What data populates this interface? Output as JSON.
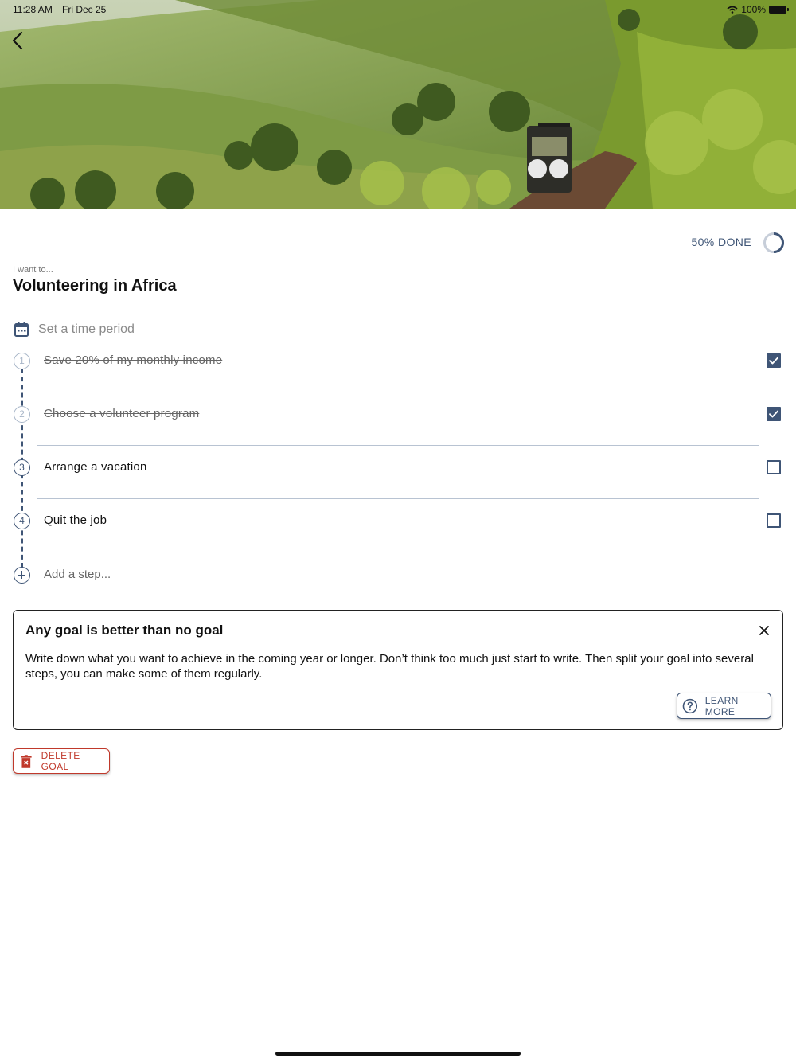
{
  "status_bar": {
    "time": "11:28 AM",
    "date": "Fri Dec 25",
    "battery": "100%"
  },
  "hero": {
    "image_icon": "safari-landscape-photo"
  },
  "progress": {
    "label": "50% DONE",
    "value": 0.5
  },
  "goal": {
    "prompt": "I want to...",
    "title": "Volunteering in Africa"
  },
  "time_period": {
    "label": "Set a time period"
  },
  "steps": [
    {
      "number": "1",
      "text": "Save 20% of my monthly income",
      "done": true
    },
    {
      "number": "2",
      "text": "Choose a volunteer program",
      "done": true
    },
    {
      "number": "3",
      "text": "Arrange a vacation",
      "done": false
    },
    {
      "number": "4",
      "text": "Quit the job",
      "done": false
    }
  ],
  "add_step": {
    "placeholder": "Add a step..."
  },
  "tip": {
    "title": "Any goal is better than no goal",
    "body": "Write down what you want to achieve in the coming year or longer. Don’t think too much just start to write. Then split your goal into several steps, you can make some of them regularly.",
    "learn_more_label": "LEARN MORE"
  },
  "delete": {
    "label": "DELETE GOAL"
  },
  "colors": {
    "accent": "#3f5576",
    "danger": "#c0392b"
  }
}
